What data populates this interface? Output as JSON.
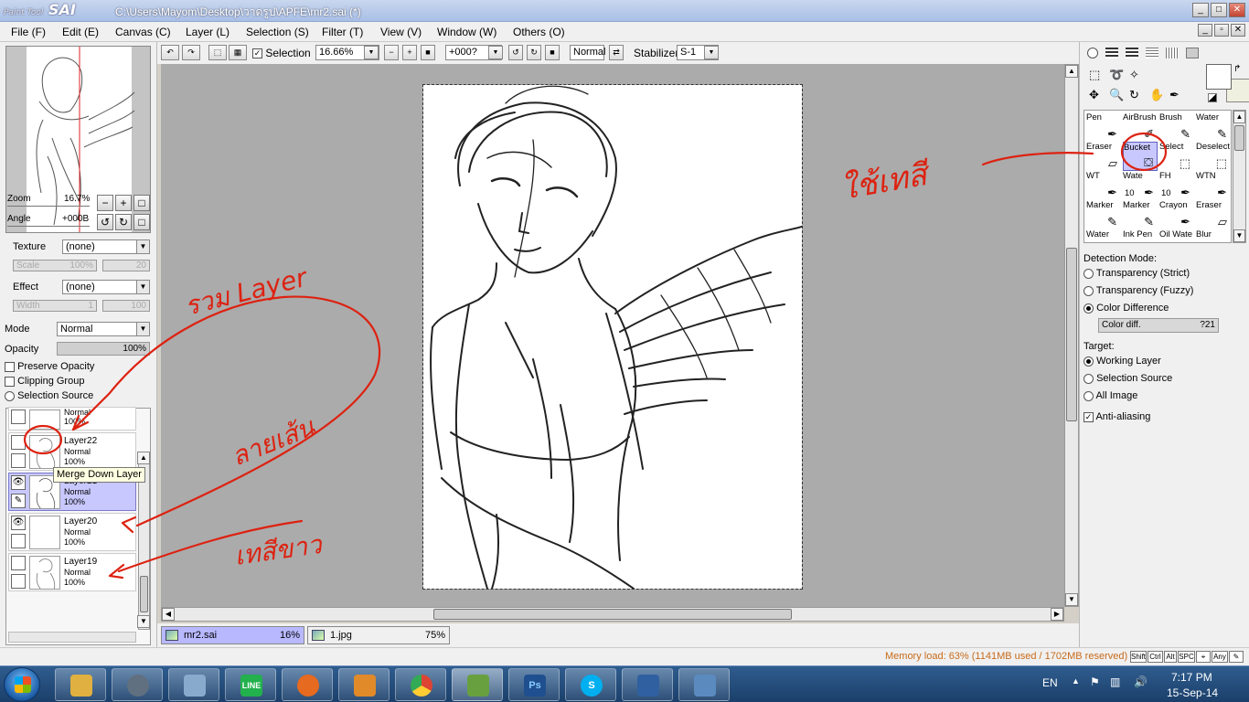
{
  "window": {
    "logo_top": "Paint Tool",
    "logo": "SAI",
    "title": "C:\\Users\\Mayom\\Desktop\\วาดรูป\\APFE\\mr2.sai (*)"
  },
  "menu": [
    "File (F)",
    "Edit (E)",
    "Canvas (C)",
    "Layer (L)",
    "Selection (S)",
    "Filter (T)",
    "View (V)",
    "Window (W)",
    "Others (O)"
  ],
  "toolbar": {
    "selection_label": "Selection",
    "selection_checked": true,
    "zoom_value": "16.66%",
    "angle_value": "+000?",
    "blend_value": "Normal",
    "stabilizer_label": "Stabilizer",
    "stabilizer_value": "S-1"
  },
  "navigator": {
    "zoom_label": "Zoom",
    "zoom_value": "16.7%",
    "angle_label": "Angle",
    "angle_value": "+000B"
  },
  "layer_props": {
    "texture_label": "Texture",
    "texture_value": "(none)",
    "scale_label": "Scale",
    "scale_value": "100%",
    "scale_num": "20",
    "effect_label": "Effect",
    "effect_value": "(none)",
    "width_label": "Width",
    "width_value": "1",
    "width_num": "100",
    "mode_label": "Mode",
    "mode_value": "Normal",
    "opacity_label": "Opacity",
    "opacity_value": "100%",
    "preserve_opacity": "Preserve Opacity",
    "clipping_group": "Clipping Group",
    "selection_source": "Selection Source"
  },
  "layers": [
    {
      "name": "",
      "mode": "Normal",
      "opacity": "100%",
      "visible": false,
      "selected": false
    },
    {
      "name": "Layer22",
      "mode": "Normal",
      "opacity": "100%",
      "visible": false,
      "selected": false
    },
    {
      "name": "Layer21",
      "mode": "Normal",
      "opacity": "100%",
      "visible": true,
      "selected": true
    },
    {
      "name": "Layer20",
      "mode": "Normal",
      "opacity": "100%",
      "visible": true,
      "selected": false
    },
    {
      "name": "Layer19",
      "mode": "Normal",
      "opacity": "100%",
      "visible": false,
      "selected": false
    }
  ],
  "tooltip": "Merge Down Layer",
  "tools": {
    "rows": [
      [
        {
          "label": "Pen",
          "icon": "pen-icon"
        },
        {
          "label": "AirBrush",
          "icon": "airbrush-icon"
        },
        {
          "label": "Brush",
          "icon": "brush-icon"
        },
        {
          "label": "Water",
          "icon": "water-icon"
        }
      ],
      [
        {
          "label": "Eraser",
          "icon": "eraser-icon"
        },
        {
          "label": "Bucket",
          "icon": "bucket-icon",
          "selected": true
        },
        {
          "label": "Select",
          "icon": "select-icon"
        },
        {
          "label": "Deselect",
          "icon": "deselect-icon"
        }
      ],
      [
        {
          "label": "WT",
          "icon": "pen-icon"
        },
        {
          "label": "Wate",
          "size": "10",
          "icon": "water-icon"
        },
        {
          "label": "FH",
          "size": "10",
          "icon": "pen-icon"
        },
        {
          "label": "WTN",
          "icon": "pen-icon"
        }
      ],
      [
        {
          "label": "Marker",
          "icon": "marker-icon"
        },
        {
          "label": "Marker",
          "icon": "marker-icon"
        },
        {
          "label": "Crayon",
          "icon": "crayon-icon"
        },
        {
          "label": "Eraser",
          "icon": "eraser-icon"
        }
      ],
      [
        {
          "label": "Water",
          "icon": "water-icon"
        },
        {
          "label": "Ink Pen",
          "icon": "pen-icon"
        },
        {
          "label": "Oil Wate",
          "icon": "water-icon"
        },
        {
          "label": "Blur",
          "icon": "blur-icon"
        }
      ]
    ]
  },
  "bucket_options": {
    "detection_label": "Detection Mode:",
    "detection": [
      {
        "label": "Transparency (Strict)",
        "on": false
      },
      {
        "label": "Transparency (Fuzzy)",
        "on": false
      },
      {
        "label": "Color Difference",
        "on": true
      }
    ],
    "color_diff_label": "Color diff.",
    "color_diff_value": "?21",
    "target_label": "Target:",
    "target": [
      {
        "label": "Working Layer",
        "on": true
      },
      {
        "label": "Selection Source",
        "on": false
      },
      {
        "label": "All Image",
        "on": false
      }
    ],
    "antialias_label": "Anti-aliasing",
    "antialias": true
  },
  "documents": [
    {
      "name": "mr2.sai",
      "zoom": "16%",
      "active": true
    },
    {
      "name": "1.jpg",
      "zoom": "75%",
      "active": false
    }
  ],
  "status": {
    "memory": "Memory load: 63% (1141MB used / 1702MB reserved)",
    "keys": [
      "Shift",
      "Ctrl",
      "Alt",
      "SPC",
      "⌖",
      "Any",
      "✎"
    ]
  },
  "annotations": {
    "merge_layer": "รวม Layer",
    "sketch": "ลายเส้น",
    "white": "เทสีขาว",
    "use_color": "ใช้เทสี"
  },
  "taskbar": {
    "apps": [
      {
        "name": "explorer",
        "glyph": "",
        "color": "#e0b040"
      },
      {
        "name": "app-2",
        "glyph": "",
        "color": "#607080"
      },
      {
        "name": "notepad",
        "glyph": "",
        "color": "#88aacc"
      },
      {
        "name": "line",
        "glyph": "LINE",
        "color": "#22b14c"
      },
      {
        "name": "firefox",
        "glyph": "",
        "color": "#e66a1f"
      },
      {
        "name": "media",
        "glyph": "",
        "color": "#e08a2a"
      },
      {
        "name": "chrome",
        "glyph": "",
        "color": "#dd4433"
      },
      {
        "name": "paint",
        "glyph": "",
        "color": "#68a040"
      },
      {
        "name": "photoshop",
        "glyph": "Ps",
        "color": "#1f4f8f"
      },
      {
        "name": "skype",
        "glyph": "S",
        "color": "#00aff0"
      },
      {
        "name": "sai",
        "glyph": "",
        "color": "#3060a0"
      },
      {
        "name": "viewer",
        "glyph": "",
        "color": "#5b8abf"
      }
    ],
    "lang": "EN",
    "time": "7:17 PM",
    "date": "15-Sep-14"
  }
}
